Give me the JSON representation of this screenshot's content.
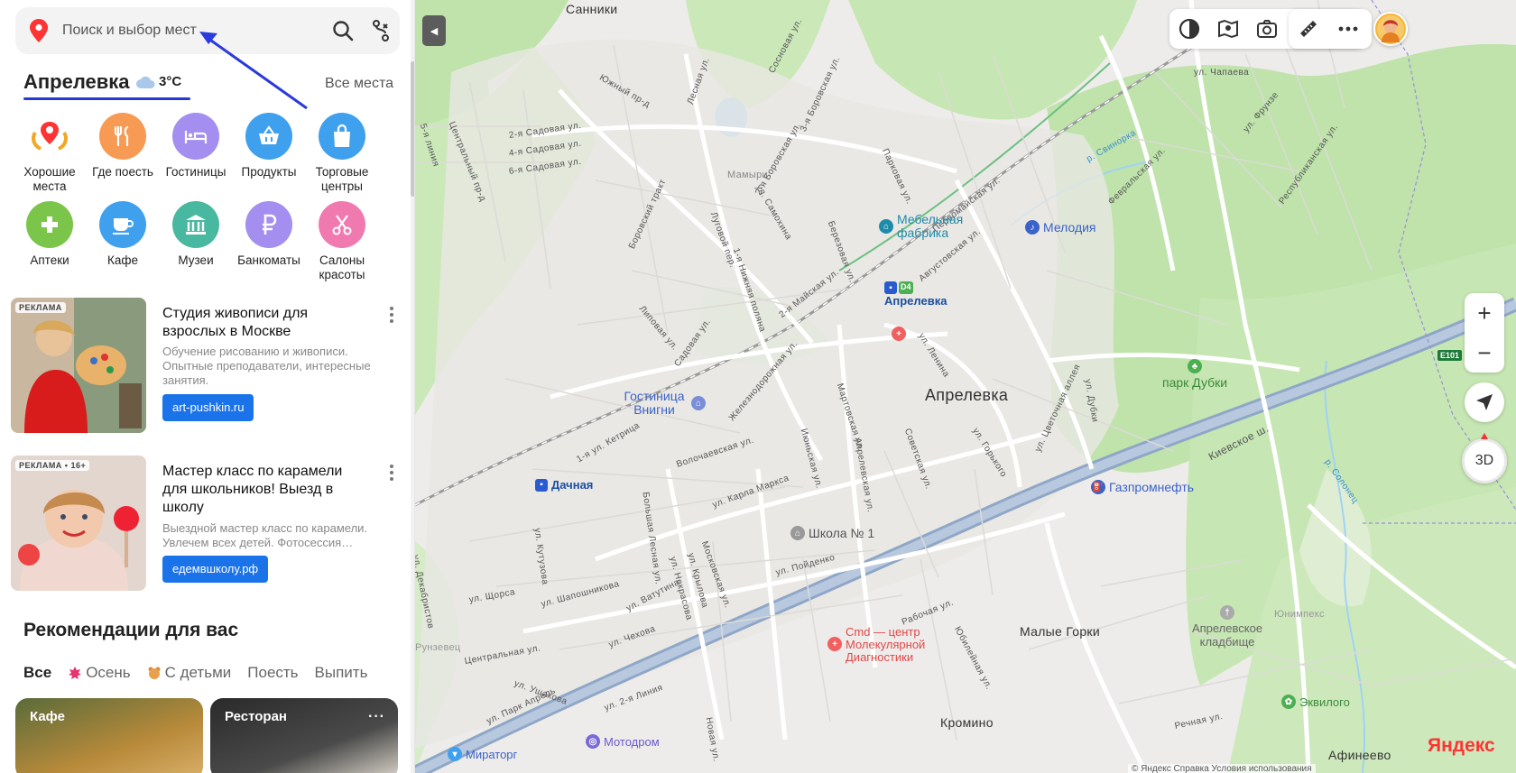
{
  "search": {
    "placeholder": "Поиск и выбор мест"
  },
  "location": {
    "city": "Апрелевка",
    "temperature": "3°C",
    "all_places": "Все места"
  },
  "categories": [
    {
      "label": "Хорошие места",
      "icon": "star-pin-icon",
      "color": "#ffffff"
    },
    {
      "label": "Где поесть",
      "icon": "fork-knife-icon",
      "color": "#f79a53"
    },
    {
      "label": "Гостиницы",
      "icon": "bed-icon",
      "color": "#a48ef0"
    },
    {
      "label": "Продукты",
      "icon": "basket-icon",
      "color": "#3fa0ed"
    },
    {
      "label": "Торговые центры",
      "icon": "bag-icon",
      "color": "#3fa0ed"
    },
    {
      "label": "Аптеки",
      "icon": "cross-icon",
      "color": "#7cc54b"
    },
    {
      "label": "Кафе",
      "icon": "cup-icon",
      "color": "#3fa0ed"
    },
    {
      "label": "Музеи",
      "icon": "museum-icon",
      "color": "#49b8a0"
    },
    {
      "label": "Банкоматы",
      "icon": "ruble-icon",
      "color": "#a48ef0"
    },
    {
      "label": "Салоны красоты",
      "icon": "scissors-icon",
      "color": "#f07ab0"
    }
  ],
  "ads": [
    {
      "tag": "РЕКЛАМА",
      "title": "Студия живописи для взрослых в Москве",
      "description": "Обучение рисованию и живописи. Опытные преподаватели, интересные занятия.",
      "button": "art-pushkin.ru"
    },
    {
      "tag": "РЕКЛАМА • 16+",
      "title": "Мастер класс по карамели для школьников! Выезд в школу",
      "description": "Выездной мастер класс по карамели. Увлечем всех детей. Фотосессия…",
      "button": "едемвшколу.рф"
    }
  ],
  "recommendations": {
    "title": "Рекомендации для вас",
    "filters": [
      "Все",
      "Осень",
      "С детьми",
      "Поесть",
      "Выпить"
    ],
    "cards": [
      "Кафе",
      "Ресторан"
    ]
  },
  "map": {
    "places": [
      "Санники",
      "Апрелевка",
      "Мамыри",
      "Малые Горки",
      "Кромино",
      "Афинеево",
      "Юнимпекс",
      "Рунзевец"
    ],
    "pois": {
      "mebel": "Мебельная фабрика",
      "melodia": "Мелодия",
      "station": "Апрелевка",
      "d4": "D4",
      "hotel": "Гостиница Внигни",
      "dachnaya": "Дачная",
      "school": "Школа № 1",
      "gazprom": "Газпромнефть",
      "cmd": "Cmd — центр Молекулярной Диагностики",
      "park": "парк Дубки",
      "cemetery": "Апрелевское кладбище",
      "evilogo": "Эквилого",
      "miratorg": "Мираторг",
      "motodrom": "Мотодром",
      "e101": "E101"
    },
    "streets": [
      "ул. Чапаева",
      "ул. Фрунзе",
      "Республиканская ул.",
      "Февральская ул.",
      "р. Свинорка",
      "Первомайская ул.",
      "Августовская ул.",
      "Парковая ул.",
      "3-я Боровская ул.",
      "2-я Боровская ул.",
      "Сосновая ул.",
      "Лесная ул.",
      "Южный пр-д",
      "Центральный пр-д",
      "2-я Садовая ул.",
      "4-я Садовая ул.",
      "6-я Садовая ул.",
      "Боровский тракт",
      "Луговой пер.",
      "ул. Самохина",
      "Березовая ул.",
      "1-я Нижняя поляна",
      "2-я Майская ул.",
      "Липовая ул.",
      "Садовая ул.",
      "Железнодорожная ул.",
      "ул. Ленина",
      "Мартовская ул.",
      "Июньская ул.",
      "Апрелевская ул.",
      "Советская ул.",
      "ул. Горького",
      "ул. Цветочная аллея",
      "ул. Дубки",
      "Киевское ш.",
      "р. Солонец",
      "1-я ул. Кетрица",
      "Волочаевская ул.",
      "ул. Карла Маркса",
      "ул. Кутузова",
      "Большая Лесная ул.",
      "ул. Некрасова",
      "ул. Крылова",
      "Московская ул.",
      "ул. Пойденко",
      "ул. Декабристов",
      "ул. Щорса",
      "ул. Шапошникова",
      "ул. Ватутина",
      "Центральная ул.",
      "ул. Чехова",
      "Рабочая ул.",
      "Юбилейная ул.",
      "ул. Ушакова",
      "ул. Парк Апрель",
      "ул. 2-я Линия",
      "Новая ул.",
      "Речная ул.",
      "5-я линия"
    ],
    "zoom_in": "+",
    "zoom_out": "−",
    "btn_3d": "3D",
    "logo": "Яндекс",
    "footer": "© Яндекс  Справка  Условия использования",
    "scale": "400 м"
  },
  "toolbar_icons": [
    "layers-icon",
    "panorama-icon",
    "camera-icon",
    "transport-icon",
    "overlay-icon",
    "ruler-icon",
    "more-icon"
  ]
}
